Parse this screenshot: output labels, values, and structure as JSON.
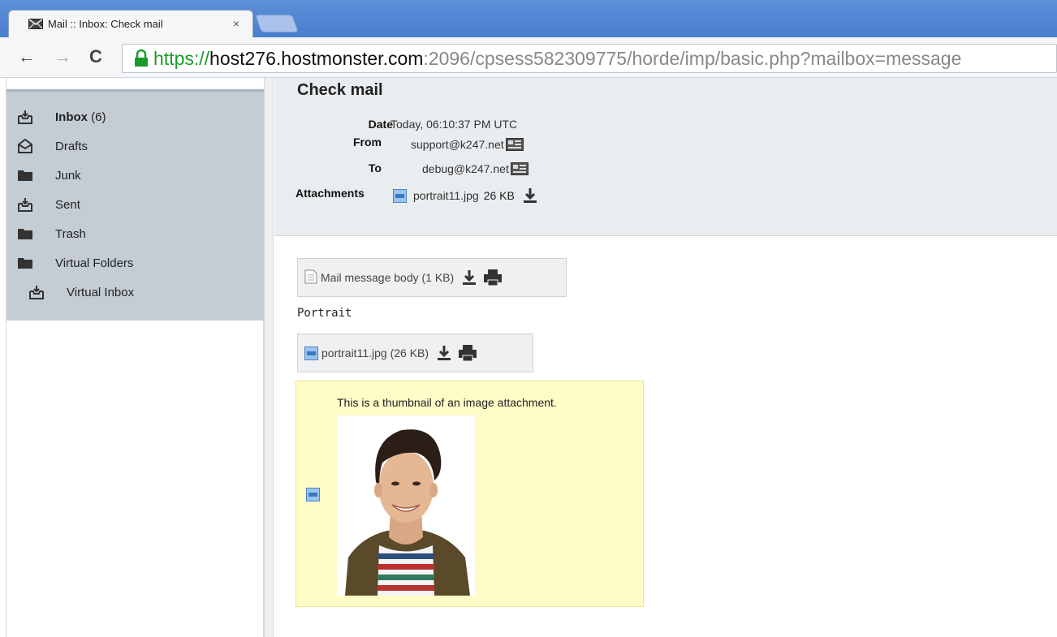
{
  "browser": {
    "tab_title": "Mail :: Inbox: Check mail",
    "tab_close": "×",
    "url_scheme": "https://",
    "url_host": "host276.hostmonster.com",
    "url_rest": ":2096/cpsess582309775/horde/imp/basic.php?mailbox=message",
    "back": "←",
    "forward": "→",
    "reload": "C"
  },
  "sidebar": {
    "folders": [
      {
        "label": "Inbox",
        "count": "(6)",
        "icon": "inbox-icon"
      },
      {
        "label": "Drafts",
        "icon": "drafts-icon"
      },
      {
        "label": "Junk",
        "icon": "folder-icon"
      },
      {
        "label": "Sent",
        "icon": "inbox-icon"
      },
      {
        "label": "Trash",
        "icon": "folder-icon"
      },
      {
        "label": "Virtual Folders",
        "icon": "folder-icon"
      },
      {
        "label": "Virtual Inbox",
        "icon": "inbox-icon"
      }
    ]
  },
  "message": {
    "title": "Check mail",
    "date_label": "Date",
    "date_value": "Today, 06:10:37 PM UTC",
    "from_label": "From",
    "from_value": "support@k247.net",
    "to_label": "To",
    "to_value": "debug@k247.net",
    "attachments_label": "Attachments",
    "attachment_name": "portrait11.jpg",
    "attachment_size": "26 KB"
  },
  "body": {
    "mail_body_part": "Mail message body (1 KB)",
    "text": "Portrait",
    "image_part": "portrait11.jpg (26 KB)",
    "thumb_caption": "This is a thumbnail of an image attachment."
  },
  "colors": {
    "sidebar_bg": "#c5cdd4",
    "header_bg": "#eaedef",
    "thumb_bg": "#fffcc8",
    "tabstrip": "#4a7fcf",
    "secure_green": "#1a9a2a"
  }
}
